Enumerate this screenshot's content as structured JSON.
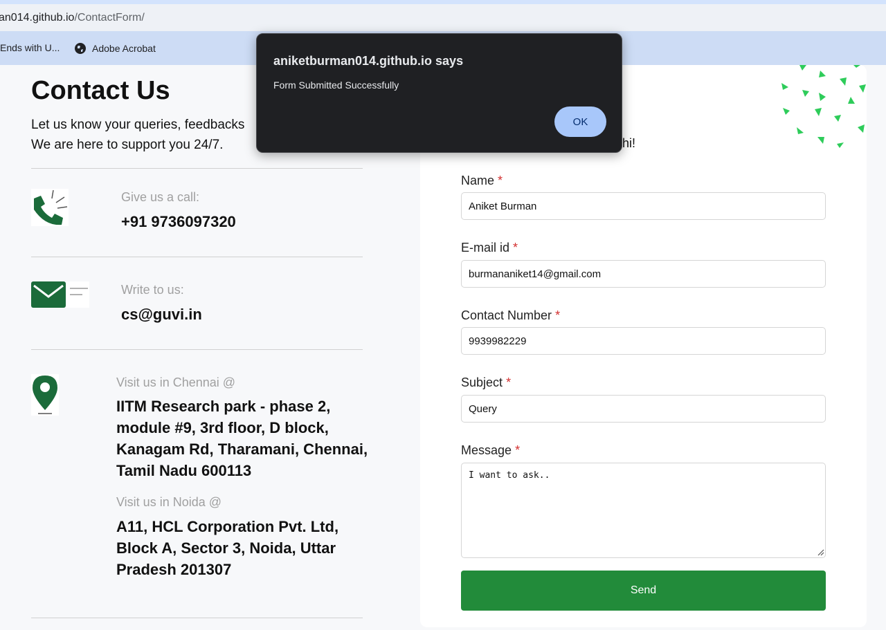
{
  "browser": {
    "url_host": "an014.github.io",
    "url_path": "/ContactForm/",
    "bookmarks": [
      {
        "label": "Ends with U..."
      },
      {
        "label": "Adobe Acrobat",
        "icon": "globe-icon"
      }
    ]
  },
  "page": {
    "title": "Contact Us",
    "intro_line1": "Let us know your queries, feedbacks",
    "intro_line2": "We are here to support you 24/7.",
    "call": {
      "label": "Give us a call:",
      "value": "+91 9736097320",
      "icon": "phone-icon"
    },
    "email": {
      "label": "Write to us:",
      "value": "cs@guvi.in",
      "icon": "envelope-icon"
    },
    "chennai": {
      "label": "Visit us in Chennai @",
      "lines": [
        "IITM Research park - phase 2,",
        "module #9, 3rd floor, D block,",
        "Kanagam Rd, Tharamani, Chennai,",
        "Tamil Nadu 600113"
      ],
      "icon": "location-pin-icon"
    },
    "noida": {
      "label": "Visit us in Noida @",
      "lines": [
        "A11, HCL Corporation Pvt. Ltd,",
        "Block A, Sector 3, Noida, Uttar",
        "Pradesh 201307"
      ]
    }
  },
  "form": {
    "partial_text": "hi!",
    "required_mark": "*",
    "name": {
      "label": "Name",
      "value": "Aniket Burman"
    },
    "email": {
      "label": "E-mail id",
      "value": "burmananiket14@gmail.com"
    },
    "contact": {
      "label": "Contact Number",
      "value": "9939982229"
    },
    "subject": {
      "label": "Subject",
      "value": "Query"
    },
    "message": {
      "label": "Message",
      "value": "I want to ask.."
    },
    "send_label": "Send"
  },
  "dialog": {
    "title": "aniketburman014.github.io says",
    "message": "Form Submitted Successfully",
    "ok_label": "OK"
  },
  "colors": {
    "accent_green": "#228b3a",
    "dialog_bg": "#1f2023",
    "dialog_button": "#a8c7fa",
    "required": "#d32f2f"
  }
}
